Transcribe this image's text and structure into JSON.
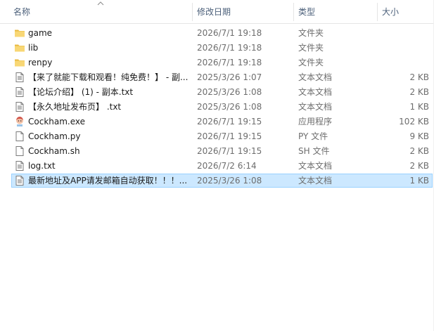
{
  "columns": {
    "name": "名称",
    "date": "修改日期",
    "type": "类型",
    "size": "大小"
  },
  "files": [
    {
      "icon": "folder-icon",
      "name": "game",
      "date": "2026/7/1 19:18",
      "type": "文件夹",
      "size": ""
    },
    {
      "icon": "folder-icon",
      "name": "lib",
      "date": "2026/7/1 19:18",
      "type": "文件夹",
      "size": ""
    },
    {
      "icon": "folder-icon",
      "name": "renpy",
      "date": "2026/7/1 19:18",
      "type": "文件夹",
      "size": ""
    },
    {
      "icon": "text-file-icon",
      "name": "【来了就能下载和观看！纯免费！】 - 副...",
      "date": "2025/3/26 1:07",
      "type": "文本文档",
      "size": "2 KB"
    },
    {
      "icon": "text-file-icon",
      "name": "【论坛介绍】 (1) - 副本.txt",
      "date": "2025/3/26 1:08",
      "type": "文本文档",
      "size": "2 KB"
    },
    {
      "icon": "text-file-icon",
      "name": "【永久地址发布页】 .txt",
      "date": "2025/3/26 1:08",
      "type": "文本文档",
      "size": "1 KB"
    },
    {
      "icon": "app-exe-icon",
      "name": "Cockham.exe",
      "date": "2026/7/1 19:15",
      "type": "应用程序",
      "size": "102 KB"
    },
    {
      "icon": "blank-file-icon",
      "name": "Cockham.py",
      "date": "2026/7/1 19:15",
      "type": "PY 文件",
      "size": "9 KB"
    },
    {
      "icon": "blank-file-icon",
      "name": "Cockham.sh",
      "date": "2026/7/1 19:15",
      "type": "SH 文件",
      "size": "2 KB"
    },
    {
      "icon": "text-file-icon",
      "name": "log.txt",
      "date": "2026/7/2 6:14",
      "type": "文本文档",
      "size": "2 KB"
    },
    {
      "icon": "text-file-icon",
      "name": "最新地址及APP请发邮箱自动获取！！！...",
      "date": "2025/3/26 1:08",
      "type": "文本文档",
      "size": "1 KB"
    }
  ],
  "selected_index": 10,
  "colors": {
    "header_text": "#4c607a",
    "selection_bg": "#cce8ff",
    "selection_border": "#99d1ff",
    "folder": "#f8d775"
  }
}
